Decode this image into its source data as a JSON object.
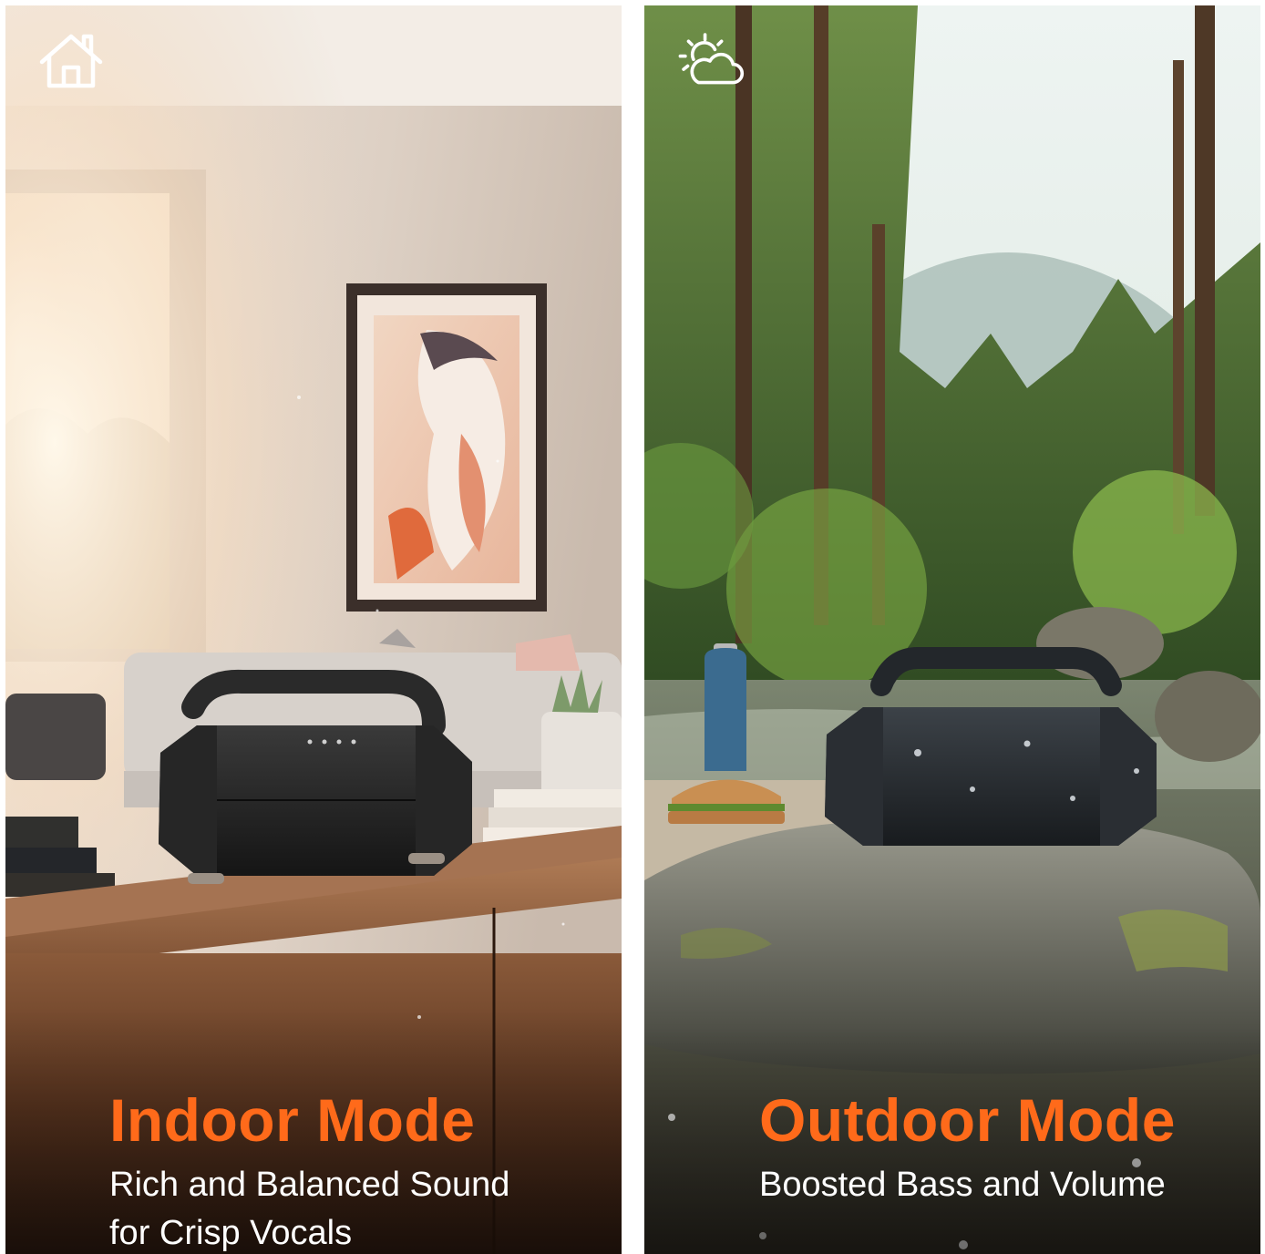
{
  "colors": {
    "accent": "#ff6a1a",
    "text_light": "#ffffff"
  },
  "panels": [
    {
      "icon": "house-icon",
      "title": "Indoor Mode",
      "description_lines": [
        "Rich and Balanced Sound",
        "for Crisp Vocals"
      ]
    },
    {
      "icon": "sun-cloud-icon",
      "title": "Outdoor Mode",
      "description_lines": [
        "Boosted Bass and Volume"
      ]
    }
  ]
}
